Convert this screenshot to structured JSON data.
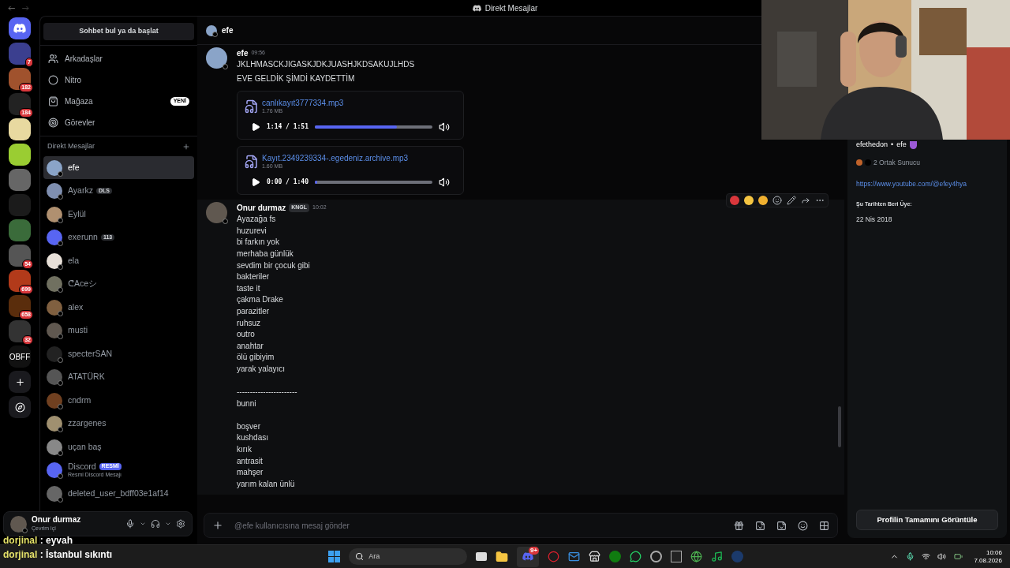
{
  "title_bar": {
    "title": "Direkt Mesajlar"
  },
  "servers": [
    {
      "kind": "home"
    },
    {
      "kind": "icon",
      "badge": "7"
    },
    {
      "kind": "icon",
      "badge": "182"
    },
    {
      "kind": "icon",
      "badge": "184"
    },
    {
      "kind": "icon"
    },
    {
      "kind": "icon"
    },
    {
      "kind": "icon"
    },
    {
      "kind": "icon"
    },
    {
      "kind": "icon"
    },
    {
      "kind": "icon",
      "badge": "54"
    },
    {
      "kind": "icon",
      "badge": "699"
    },
    {
      "kind": "icon",
      "badge": "658"
    },
    {
      "kind": "icon",
      "badge": "32"
    },
    {
      "kind": "text",
      "label": "OBFF"
    },
    {
      "kind": "add"
    },
    {
      "kind": "explore"
    }
  ],
  "dm_sidebar": {
    "search": "Sohbet bul ya da başlat",
    "nav": [
      {
        "label": "Arkadaşlar"
      },
      {
        "label": "Nitro"
      },
      {
        "label": "Mağaza",
        "badge": "YENİ"
      },
      {
        "label": "Görevler"
      }
    ],
    "section_title": "Direkt Mesajlar",
    "dms": [
      {
        "name": "efe",
        "selected": true
      },
      {
        "name": "Ayarkz",
        "selected": false,
        "tag": "DLS"
      },
      {
        "name": "Eylül",
        "selected": false
      },
      {
        "name": "exerunn",
        "selected": false,
        "tag": "113"
      },
      {
        "name": "ela",
        "selected": false
      },
      {
        "name": "ᕦAceシ",
        "selected": false
      },
      {
        "name": "alex",
        "selected": false
      },
      {
        "name": "musti",
        "selected": false
      },
      {
        "name": "specterSAN",
        "selected": false
      },
      {
        "name": "ATATÜRK",
        "selected": false
      },
      {
        "name": "cndrm",
        "selected": false
      },
      {
        "name": "zzargenes",
        "selected": false
      },
      {
        "name": "uçan baş",
        "selected": false
      },
      {
        "name": "Discord",
        "selected": false,
        "tag": "RESMİ",
        "subtitle": "Resmi Discord Mesajı"
      },
      {
        "name": "deleted_user_bdff03e1af14",
        "selected": false
      }
    ],
    "user": {
      "name": "Onur durmaz",
      "status": "Çevrim içi"
    }
  },
  "chat": {
    "header": "efe",
    "messages": [
      {
        "author": "efe",
        "time": "09:56",
        "hovered": false,
        "paragraphs": [
          [
            "JKLHMASCKJIGASKJDKJUASHJKDSAKUJLHDS"
          ],
          [
            "EVE GELDİK ŞİMDİ KAYDETTİM"
          ]
        ],
        "attachments": [
          {
            "name": "canlıkayıt3777334.mp3",
            "size": "1.76 MB",
            "time": "1:14 / 1:51",
            "level": 0.7
          },
          {
            "name": "Kayıt.2349239334-.egedeniz.archive.mp3",
            "size": "1.60 MB",
            "time": "0:00 / 1:40",
            "level": 0
          }
        ]
      },
      {
        "author": "Onur durmaz",
        "tag": "KNGL",
        "time": "10:02",
        "hovered": true,
        "paragraphs": [
          [
            "Ayazağa fs",
            "huzurevi",
            "bi farkın yok",
            "merhaba günlük",
            "sevdim bir çocuk gibi",
            "bakteriler",
            "taste it",
            "çakma Drake",
            "parazitler",
            "ruhsuz",
            "outro",
            "anahtar",
            "ölü gibiyim",
            "yarak yalayıcı"
          ],
          [
            "-----------------------",
            "bunni"
          ],
          [
            "boşver",
            "kushdası",
            "kırık",
            "antrasit",
            "mahşer",
            "yarım kalan ünlü"
          ]
        ]
      }
    ],
    "composer": {
      "placeholder": "@efe kullanıcısına mesaj gönder"
    }
  },
  "profile": {
    "username": "efethedon",
    "separator": "•",
    "display_name": "efe",
    "mutual": "2 Ortak Sunucu",
    "link": "https://www.youtube.com/@efey4hya",
    "member_since_label": "Şu Tarihten Beri Üye:",
    "member_since": "22 Nis 2018",
    "button": "Profilin Tamamını Görüntüle"
  },
  "stream_chat": [
    {
      "user": "dorjinal",
      "text": ": eyvah"
    },
    {
      "user": "dorjinal",
      "text": ": İstanbul sıkıntı"
    }
  ],
  "taskbar": {
    "search": "Ara",
    "discord_badge": "9+",
    "time": "10:06",
    "date": "7.08.2026"
  }
}
